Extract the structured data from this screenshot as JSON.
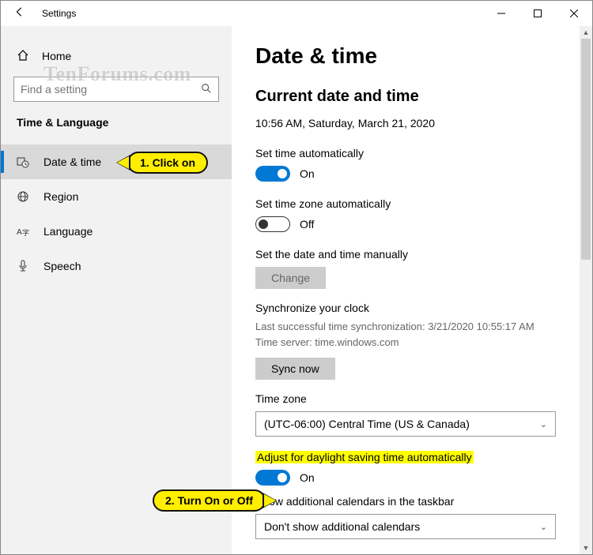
{
  "window": {
    "title": "Settings"
  },
  "watermark": "TenForums.com",
  "sidebar": {
    "home": "Home",
    "search_placeholder": "Find a setting",
    "category": "Time & Language",
    "items": [
      {
        "label": "Date & time",
        "icon": "clock-calendar-icon",
        "active": true
      },
      {
        "label": "Region",
        "icon": "globe-icon",
        "active": false
      },
      {
        "label": "Language",
        "icon": "language-icon",
        "active": false
      },
      {
        "label": "Speech",
        "icon": "microphone-icon",
        "active": false
      }
    ]
  },
  "page": {
    "heading": "Date & time",
    "subheading": "Current date and time",
    "current_time": "10:56 AM, Saturday, March 21, 2020",
    "set_time_auto": {
      "label": "Set time automatically",
      "state": "On",
      "on": true
    },
    "set_tz_auto": {
      "label": "Set time zone automatically",
      "state": "Off",
      "on": false
    },
    "manual": {
      "label": "Set the date and time manually",
      "button": "Change"
    },
    "sync": {
      "label": "Synchronize your clock",
      "last": "Last successful time synchronization: 3/21/2020 10:55:17 AM",
      "server": "Time server: time.windows.com",
      "button": "Sync now"
    },
    "timezone": {
      "label": "Time zone",
      "value": "(UTC-06:00) Central Time (US & Canada)"
    },
    "dst": {
      "label": "Adjust for daylight saving time automatically",
      "state": "On",
      "on": true
    },
    "calendars": {
      "label": "Show additional calendars in the taskbar",
      "value": "Don't show additional calendars"
    }
  },
  "callouts": {
    "one": "1. Click on",
    "two": "2. Turn On or Off"
  }
}
